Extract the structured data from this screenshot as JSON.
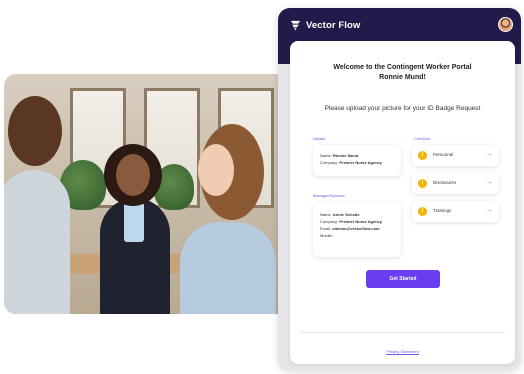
{
  "brand": {
    "name": "Vector Flow"
  },
  "welcome": {
    "line1": "Welcome to the Contingent Worker Portal",
    "line2": "Ronnie Mund!"
  },
  "upload_prompt": "Please upload your picture for your ID Badge Request",
  "details": {
    "label": "Details",
    "name_label": "Name:",
    "name": "Ronnie Mund",
    "company_label": "Company:",
    "company": "Premier Nurse Agency"
  },
  "manager": {
    "label": "Manager/Sponsor",
    "name_label": "Name:",
    "name": "Annie Schultz",
    "company_label": "Company:",
    "company": "Premier Nurse Agency",
    "email_label": "Email:",
    "email": "vtdemo@vectorflow.com",
    "mobile_label": "Mobile:",
    "mobile": ""
  },
  "checklist": {
    "label": "Checklist",
    "items": [
      {
        "label": "Personnel",
        "status_icon": "exclamation-icon"
      },
      {
        "label": "Disclosures",
        "status_icon": "exclamation-icon"
      },
      {
        "label": "Trainings",
        "status_icon": "exclamation-icon"
      }
    ]
  },
  "cta": {
    "label": "Get Started"
  },
  "footer": {
    "privacy": "Privacy Statement"
  },
  "colors": {
    "header": "#231a4a",
    "accent": "#6a3df0",
    "warning": "#f5b400"
  }
}
